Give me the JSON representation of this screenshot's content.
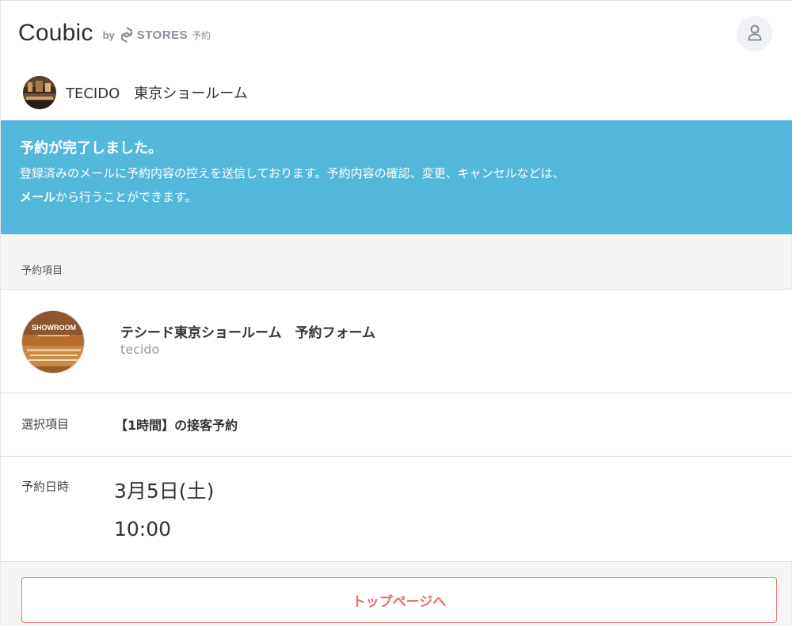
{
  "header": {
    "logo_word": "Coubic",
    "logo_by": "by",
    "logo_stores": "STORES",
    "logo_yoyaku": "予約"
  },
  "shop": {
    "name": "TECIDO　東京ショールーム"
  },
  "banner": {
    "title": "予約が完了しました。",
    "line1": "登録済みのメールに予約内容の控えを送信しております。予約内容の確認、変更、キャンセルなどは、",
    "line2_bold": "メール",
    "line2_rest": "から行うことができます。"
  },
  "section": {
    "label": "予約項目"
  },
  "form": {
    "title": "テシード東京ショールーム　予約フォーム",
    "subtitle": "tecido",
    "thumb_text": "SHOWROOM"
  },
  "selection": {
    "label": "選択項目",
    "value": "【1時間】の接客予約"
  },
  "datetime": {
    "label": "予約日時",
    "date": "3月5日(土)",
    "time": "10:00"
  },
  "actions": {
    "top_page": "トップページへ"
  },
  "colors": {
    "banner": "#53b8dc",
    "accent": "#ea6a6d"
  }
}
